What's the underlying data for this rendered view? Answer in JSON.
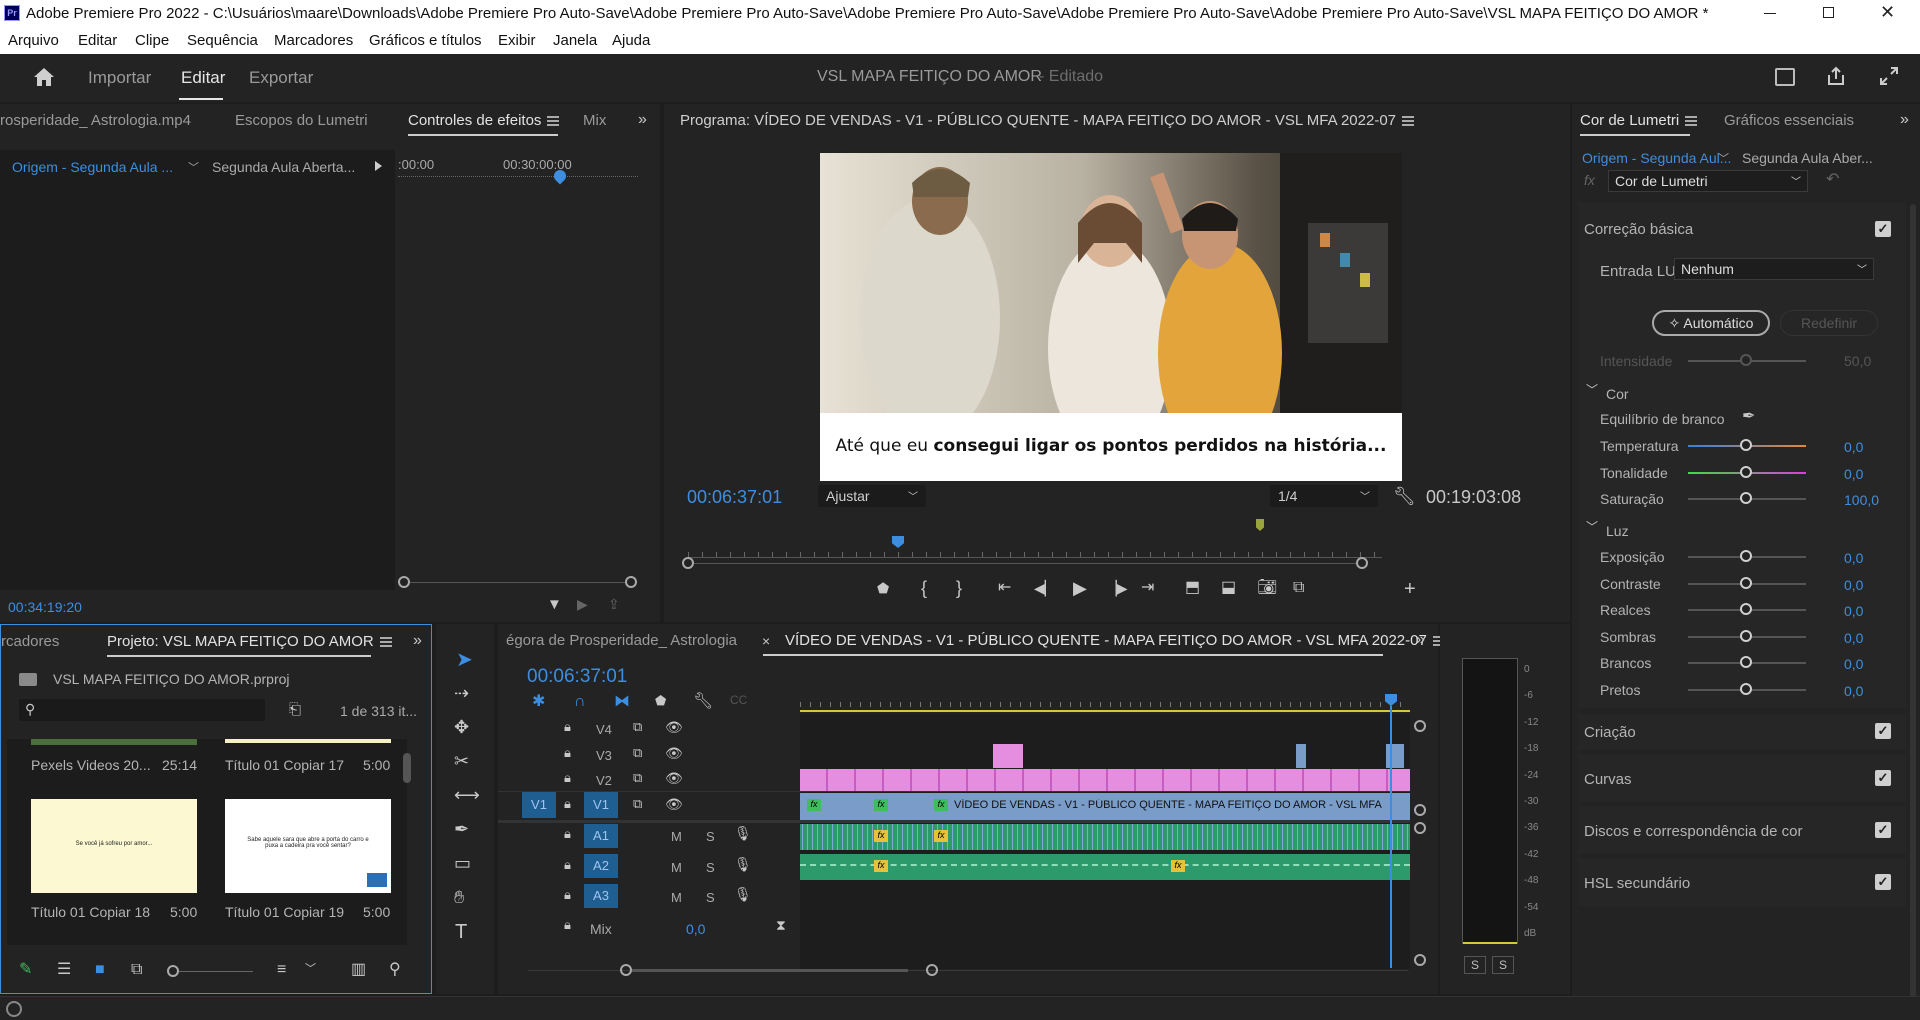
{
  "titlebar": {
    "text": "Adobe Premiere Pro 2022 - C:\\Usuários\\maare\\Downloads\\Adobe Premiere Pro Auto-Save\\Adobe Premiere Pro Auto-Save\\Adobe Premiere Pro Auto-Save\\Adobe Premiere Pro Auto-Save\\Adobe Premiere Pro Auto-Save\\VSL MAPA FEITIÇO DO AMOR *",
    "app_icon": "Pr"
  },
  "menu": [
    "Arquivo",
    "Editar",
    "Clipe",
    "Sequência",
    "Marcadores",
    "Gráficos e títulos",
    "Exibir",
    "Janela",
    "Ajuda"
  ],
  "workspace": {
    "tabs": [
      "Importar",
      "Editar",
      "Exportar"
    ],
    "active": "Editar",
    "project_name": "VSL MAPA FEITIÇO DO AMOR",
    "status": "- Editado"
  },
  "source_panel": {
    "tabs": [
      "rosperidade_ Astrologia.mp4",
      "Escopos do Lumetri",
      "Controles de efeitos",
      "Mix"
    ],
    "active": "Controles de efeitos",
    "origin": "Origem - Segunda Aula ...",
    "target": "Segunda Aula Aberta...",
    "t0": ":00:00",
    "t1": "00:30:00:00",
    "timecode": "00:34:19:20"
  },
  "program": {
    "title": "Programa: VÍDEO DE VENDAS - V1 - PÚBLICO QUENTE - MAPA FEITIÇO DO AMOR - VSL MFA 2022-07",
    "caption_normal": "Até que eu ",
    "caption_bold": "consegui ligar os pontos perdidos na história...",
    "timecode": "00:06:37:01",
    "fit": "Ajustar",
    "resolution": "1/4",
    "duration": "00:19:03:08"
  },
  "lumetri": {
    "tabs": [
      "Cor de Lumetri",
      "Gráficos essenciais"
    ],
    "origin": "Origem - Segunda Aul...",
    "target": "Segunda Aula Aber...",
    "effect": "Cor de Lumetri",
    "basic": "Correção básica",
    "lut_label": "Entrada LUT",
    "lut_value": "Nenhum",
    "auto_btn": "Automático",
    "reset_btn": "Redefinir",
    "intensity_label": "Intensidade",
    "intensity_value": "50,0",
    "color_section": "Cor",
    "wb_label": "Equilíbrio de branco",
    "color_rows": [
      {
        "label": "Temperatura",
        "value": "0,0"
      },
      {
        "label": "Tonalidade",
        "value": "0,0"
      },
      {
        "label": "Saturação",
        "value": "100,0"
      }
    ],
    "light_section": "Luz",
    "light_rows": [
      {
        "label": "Exposição",
        "value": "0,0"
      },
      {
        "label": "Contraste",
        "value": "0,0"
      },
      {
        "label": "Realces",
        "value": "0,0"
      },
      {
        "label": "Sombras",
        "value": "0,0"
      },
      {
        "label": "Brancos",
        "value": "0,0"
      },
      {
        "label": "Pretos",
        "value": "0,0"
      }
    ],
    "sections": [
      "Criação",
      "Curvas",
      "Discos e correspondência de cor",
      "HSL secundário"
    ]
  },
  "project": {
    "tabs": [
      "rcadores",
      "Projeto: VSL MAPA FEITIÇO DO AMOR"
    ],
    "file": "VSL MAPA FEITIÇO DO AMOR.prproj",
    "count": "1 de 313 it...",
    "items": [
      {
        "name": "Pexels Videos 20...",
        "dur": "25:14"
      },
      {
        "name": "Título 01 Copiar 17",
        "dur": "5:00"
      },
      {
        "name": "Título 01 Copiar 18",
        "dur": "5:00",
        "thumb": "Se você já sofreu por amor..."
      },
      {
        "name": "Título 01 Copiar 19",
        "dur": "5:00",
        "thumb": "Sabe aquele sara que abre a porta do carro e puxa a cadeira pra você sentar?"
      }
    ]
  },
  "timeline": {
    "tab_left": "égora de Prosperidade_ Astrologia",
    "tab_active": "VÍDEO DE VENDAS - V1 - PÚBLICO QUENTE - MAPA FEITIÇO DO AMOR - VSL MFA 2022-07",
    "timecode": "00:06:37:01",
    "video_tracks": [
      "V4",
      "V3",
      "V2",
      "V1"
    ],
    "audio_tracks": [
      "A1",
      "A2",
      "A3"
    ],
    "source_patch": "V1",
    "mix_label": "Mix",
    "mix_value": "0,0",
    "main_clip": "VÍDEO DE VENDAS - V1 - PÚBLICO QUENTE - MAPA FEITIÇO DO AMOR - VSL MFA",
    "m": "M",
    "s": "S"
  },
  "meter": {
    "scale": [
      "0",
      "-6",
      "-12",
      "-18",
      "-24",
      "-30",
      "-36",
      "-42",
      "-48",
      "-54",
      "dB"
    ],
    "solo": [
      "S",
      "S"
    ]
  },
  "colors": {
    "accent": "#3d8ee0",
    "pink": "#e58ee0",
    "v1blue": "#7a9cc8",
    "audio": "#2d9a6c",
    "track_blue": "#1f5e91"
  }
}
